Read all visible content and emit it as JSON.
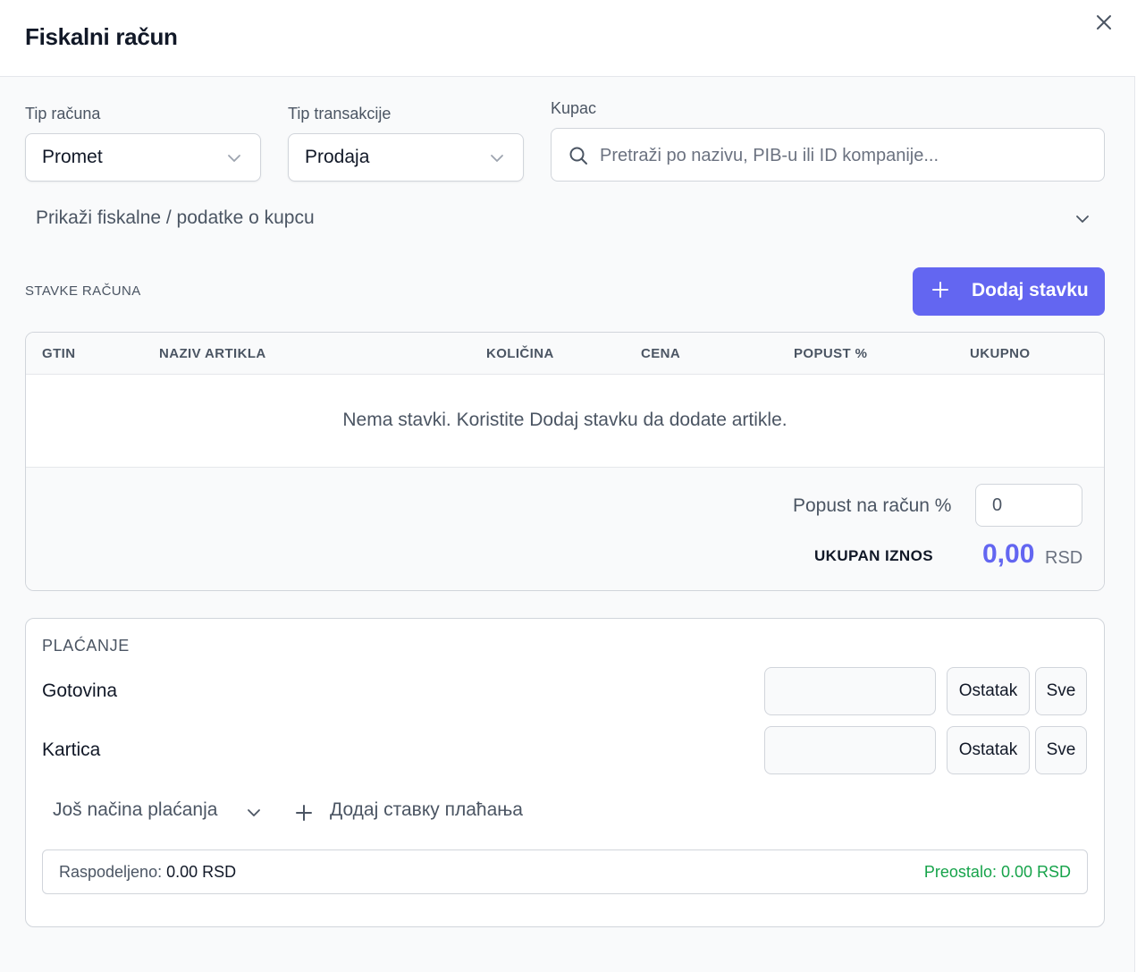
{
  "dialog": {
    "title": "Fiskalni račun"
  },
  "form": {
    "receipt_type": {
      "label": "Tip računa",
      "value": "Promet"
    },
    "transaction_type": {
      "label": "Tip transakcije",
      "value": "Prodaja"
    },
    "customer": {
      "label": "Kupac",
      "placeholder": "Pretraži po nazivu, PIB-u ili ID kompanije..."
    },
    "expander_label": "Prikaži fiskalne / podatke o kupcu"
  },
  "items": {
    "section_title": "STAVKE RAČUNA",
    "add_button": "Dodaj stavku",
    "columns": [
      "GTIN",
      "NAZIV ARTIKLA",
      "KOLIČINA",
      "CENA",
      "POPUST %",
      "UKUPNO"
    ],
    "empty_message": "Nema stavki. Koristite Dodaj stavku da dodate artikle.",
    "discount_label": "Popust na račun %",
    "discount_value": "0",
    "total_label": "UKUPAN IZNOS",
    "total_value": "0,00",
    "currency": "RSD"
  },
  "payment": {
    "title": "PLAĆANJE",
    "methods": [
      {
        "label": "Gotovina",
        "remainder_button": "Ostatak",
        "all_button": "Sve"
      },
      {
        "label": "Kartica",
        "remainder_button": "Ostatak",
        "all_button": "Sve"
      }
    ],
    "more_methods": "Još načina plaćanja",
    "add_payment": "Додај ставку плаћања",
    "allocated_label": "Raspodeljeno:",
    "allocated_value": "0.00 RSD",
    "remaining": "Preostalo: 0.00 RSD"
  },
  "colors": {
    "accent": "#6366f1",
    "success": "#16a34a"
  }
}
